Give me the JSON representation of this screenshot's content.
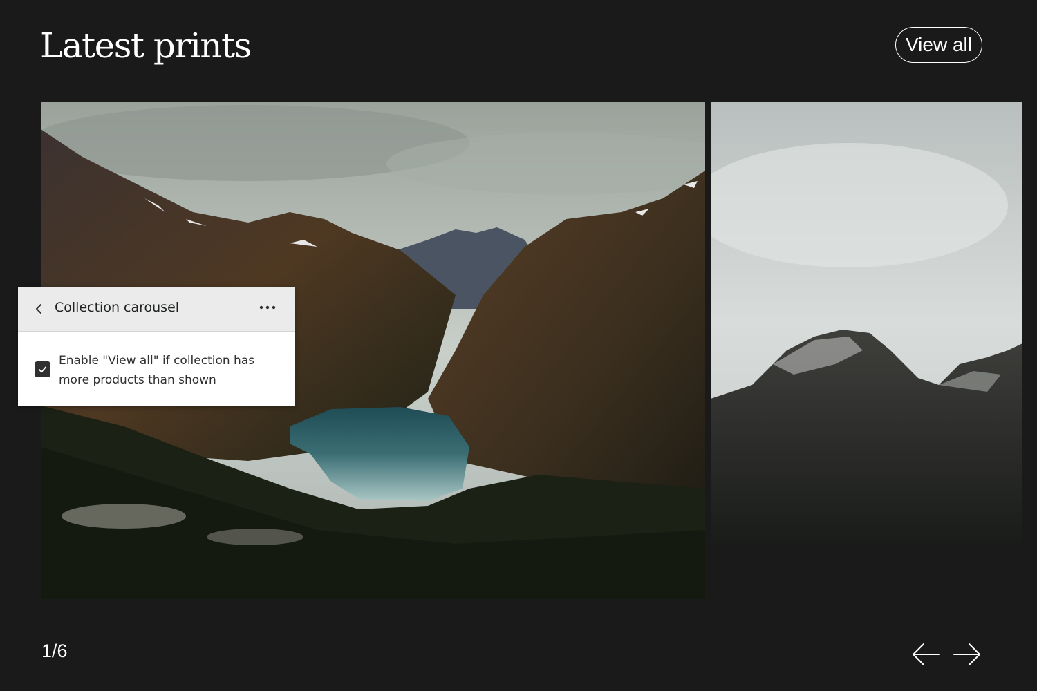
{
  "header": {
    "title": "Latest prints",
    "view_all_label": "View all"
  },
  "carousel": {
    "slides": [
      {
        "name": "mountain-lake-valley-print"
      },
      {
        "name": "misty-peak-print"
      }
    ],
    "pagination": "1/6",
    "prev_icon": "arrow-left-icon",
    "next_icon": "arrow-right-icon"
  },
  "editor_panel": {
    "title": "Collection carousel",
    "back_icon": "chevron-left-icon",
    "menu_icon": "more-horizontal-icon",
    "checkbox": {
      "label": "Enable \"View all\" if collection has more products than shown",
      "checked": true
    }
  },
  "colors": {
    "background": "#1a1a1a",
    "text": "#ffffff",
    "panel_header": "#ebebeb",
    "checkbox": "#303030"
  }
}
